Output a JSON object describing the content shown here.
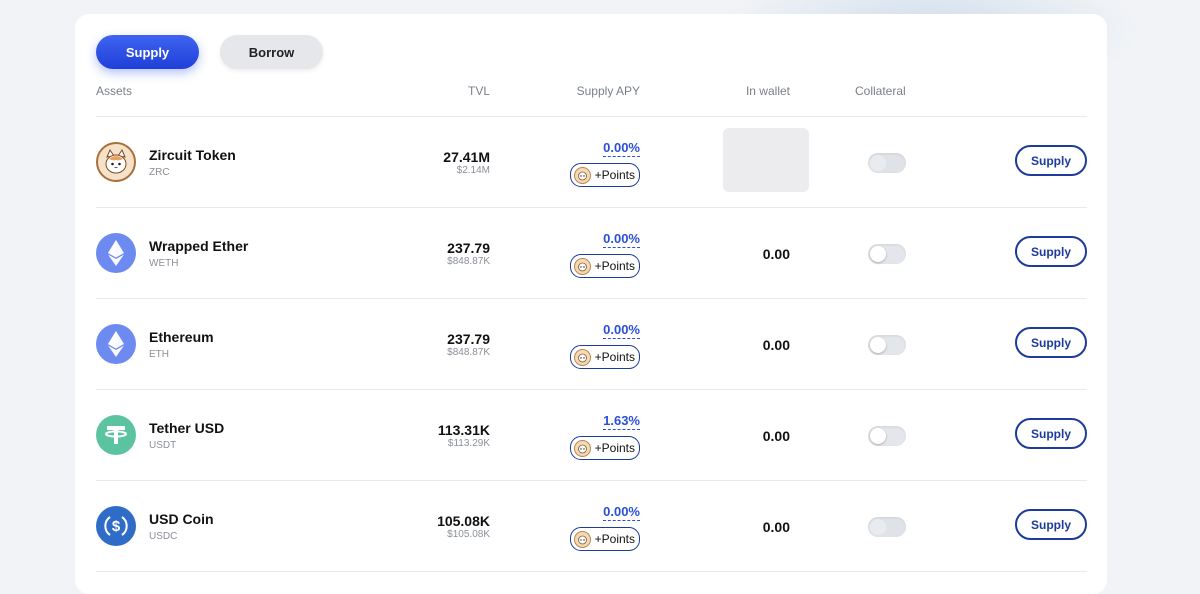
{
  "tabs": {
    "supply": "Supply",
    "borrow": "Borrow"
  },
  "columns": {
    "assets": "Assets",
    "tvl": "TVL",
    "supply_apy": "Supply APY",
    "in_wallet": "In wallet",
    "collateral": "Collateral"
  },
  "rows": [
    {
      "name": "Zircuit Token",
      "symbol": "ZRC",
      "icon": "zircuit-cat-icon",
      "tvl": "27.41M",
      "tvl_usd": "$2.14M",
      "apy": "0.00%",
      "points": "+Points",
      "wallet": "",
      "wallet_loading": true,
      "collateral_enabled": false,
      "action": "Supply"
    },
    {
      "name": "Wrapped Ether",
      "symbol": "WETH",
      "icon": "ethereum-icon",
      "tvl": "237.79",
      "tvl_usd": "$848.87K",
      "apy": "0.00%",
      "points": "+Points",
      "wallet": "0.00",
      "wallet_loading": false,
      "collateral_enabled": true,
      "action": "Supply"
    },
    {
      "name": "Ethereum",
      "symbol": "ETH",
      "icon": "ethereum-icon",
      "tvl": "237.79",
      "tvl_usd": "$848.87K",
      "apy": "0.00%",
      "points": "+Points",
      "wallet": "0.00",
      "wallet_loading": false,
      "collateral_enabled": true,
      "action": "Supply"
    },
    {
      "name": "Tether USD",
      "symbol": "USDT",
      "icon": "tether-icon",
      "tvl": "113.31K",
      "tvl_usd": "$113.29K",
      "apy": "1.63%",
      "points": "+Points",
      "wallet": "0.00",
      "wallet_loading": false,
      "collateral_enabled": true,
      "action": "Supply"
    },
    {
      "name": "USD Coin",
      "symbol": "USDC",
      "icon": "usdc-icon",
      "tvl": "105.08K",
      "tvl_usd": "$105.08K",
      "apy": "0.00%",
      "points": "+Points",
      "wallet": "0.00",
      "wallet_loading": false,
      "collateral_enabled": false,
      "action": "Supply"
    }
  ],
  "colors": {
    "accent": "#2a4fd8",
    "button_border": "#1d3b9a",
    "eth": "#6d8af0",
    "tether": "#5cc3a0",
    "usdc": "#2f6cc8"
  }
}
